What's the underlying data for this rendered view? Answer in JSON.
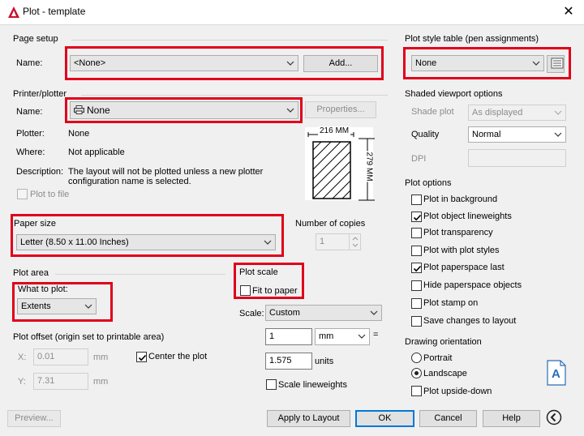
{
  "window": {
    "title": "Plot - template"
  },
  "page_setup": {
    "section_label": "Page setup",
    "name_label": "Name:",
    "name_value": "<None>",
    "add_button": "Add..."
  },
  "printer": {
    "section_label": "Printer/plotter",
    "name_label": "Name:",
    "name_value": "None",
    "properties_button": "Properties...",
    "plotter_label": "Plotter:",
    "plotter_value": "None",
    "where_label": "Where:",
    "where_value": "Not applicable",
    "description_label": "Description:",
    "description_line1": "The layout will not be plotted unless a new plotter",
    "description_line2": "configuration name is selected.",
    "plot_to_file": "Plot to file",
    "preview_width": "216 MM",
    "preview_height": "279 MM"
  },
  "paper_size": {
    "section_label": "Paper size",
    "value": "Letter (8.50 x 11.00 Inches)"
  },
  "copies": {
    "label": "Number of copies",
    "value": "1"
  },
  "plot_area": {
    "section_label": "Plot area",
    "what_label": "What to plot:",
    "what_value": "Extents"
  },
  "plot_offset": {
    "section_label": "Plot offset (origin set to printable area)",
    "x_label": "X:",
    "x_value": "0.01",
    "x_unit": "mm",
    "y_label": "Y:",
    "y_value": "7.31",
    "y_unit": "mm",
    "center_label": "Center the plot",
    "center_checked": true
  },
  "plot_scale": {
    "section_label": "Plot scale",
    "fit_label": "Fit to paper",
    "fit_checked": false,
    "scale_label": "Scale:",
    "scale_value": "Custom",
    "value1": "1",
    "unit1": "mm",
    "value2": "1.575",
    "unit2": "units",
    "equals": "=",
    "scale_lineweights": "Scale lineweights"
  },
  "plot_style": {
    "section_label": "Plot style table (pen assignments)",
    "value": "None"
  },
  "shaded": {
    "section_label": "Shaded viewport options",
    "shade_label": "Shade plot",
    "shade_value": "As displayed",
    "quality_label": "Quality",
    "quality_value": "Normal",
    "dpi_label": "DPI"
  },
  "plot_options": {
    "section_label": "Plot options",
    "items": [
      {
        "label": "Plot in background",
        "checked": false
      },
      {
        "label": "Plot object lineweights",
        "checked": true
      },
      {
        "label": "Plot transparency",
        "checked": false
      },
      {
        "label": "Plot with plot styles",
        "checked": false
      },
      {
        "label": "Plot paperspace last",
        "checked": true
      },
      {
        "label": "Hide paperspace objects",
        "checked": false
      },
      {
        "label": "Plot stamp on",
        "checked": false
      },
      {
        "label": "Save changes to layout",
        "checked": false
      }
    ]
  },
  "orientation": {
    "section_label": "Drawing orientation",
    "portrait": "Portrait",
    "landscape": "Landscape",
    "selected": "landscape",
    "upside_down": "Plot upside-down",
    "icon_letter": "A"
  },
  "footer": {
    "preview": "Preview...",
    "apply": "Apply to Layout",
    "ok": "OK",
    "cancel": "Cancel",
    "help": "Help"
  },
  "colors": {
    "highlight": "#e0001b",
    "accent": "#0078d7",
    "app_icon": "#c8102e"
  }
}
